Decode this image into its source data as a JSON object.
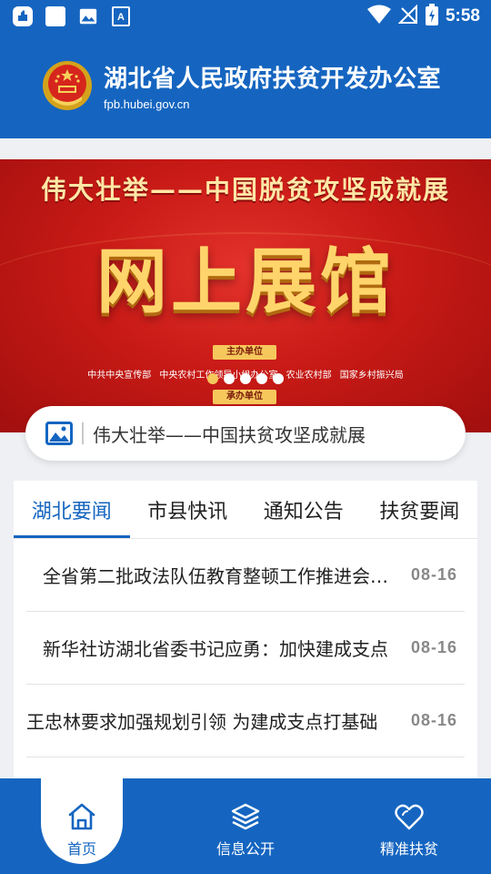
{
  "status_bar": {
    "time": "5:58",
    "icons_left": [
      "notification-icon",
      "square-icon",
      "image-icon",
      "text-icon"
    ],
    "icons_right": [
      "wifi-icon",
      "no-signal-icon",
      "battery-charging-icon"
    ]
  },
  "header": {
    "title": "湖北省人民政府扶贫开发办公室",
    "domain": "fpb.hubei.gov.cn",
    "emblem": "national-emblem"
  },
  "banner": {
    "subtitle": "伟大壮举——中国脱贫攻坚成就展",
    "main_title": "网上展馆",
    "host_tag": "主办单位",
    "organizers": "中共中央宣传部  中央农村工作领导小组办公室  农业农村部  国家乡村振兴局",
    "undertake_tag": "承办单位",
    "slide_count": 5,
    "active_slide": 1,
    "caption": "伟大壮举——中国扶贫攻坚成就展"
  },
  "tabs": [
    {
      "label": "湖北要闻",
      "active": true
    },
    {
      "label": "市县快讯",
      "active": false
    },
    {
      "label": "通知公告",
      "active": false
    },
    {
      "label": "扶贫要闻",
      "active": false
    }
  ],
  "news": [
    {
      "title": "全省第二批政法队伍教育整顿工作推进会召开",
      "date": "08-16"
    },
    {
      "title": "新华社访湖北省委书记应勇：加快建成支点",
      "date": "08-16"
    },
    {
      "title": "王忠林要求加强规划引领 为建成支点打基础",
      "date": "08-16"
    }
  ],
  "bottom_nav": [
    {
      "label": "首页",
      "icon": "home-icon",
      "active": true
    },
    {
      "label": "信息公开",
      "icon": "layers-icon",
      "active": false
    },
    {
      "label": "精准扶贫",
      "icon": "heart-icon",
      "active": false
    }
  ],
  "colors": {
    "primary": "#1565c0",
    "banner_red": "#c81a16",
    "gold": "#ffd56b"
  }
}
